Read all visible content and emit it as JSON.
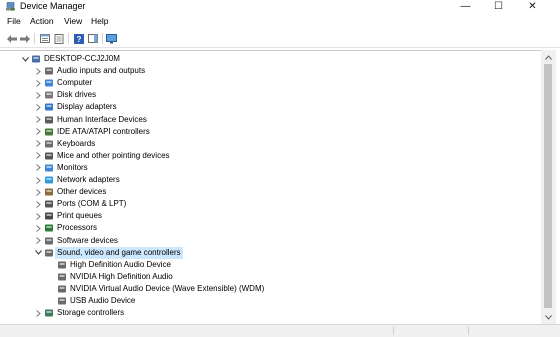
{
  "window": {
    "title": "Device Manager",
    "minimize": "—",
    "maximize": "☐",
    "close": "✕"
  },
  "menu": [
    "File",
    "Action",
    "View",
    "Help"
  ],
  "tree": {
    "root": "DESKTOP-CCJ2J0M",
    "items": [
      "Audio inputs and outputs",
      "Computer",
      "Disk drives",
      "Display adapters",
      "Human Interface Devices",
      "IDE ATA/ATAPI controllers",
      "Keyboards",
      "Mice and other pointing devices",
      "Monitors",
      "Network adapters",
      "Other devices",
      "Ports (COM & LPT)",
      "Print queues",
      "Processors",
      "Software devices",
      "Sound, video and game controllers"
    ],
    "sound_children": [
      "High Definition Audio Device",
      "NVIDIA High Definition Audio",
      "NVIDIA Virtual Audio Device (Wave Extensible) (WDM)",
      "USB Audio Device"
    ],
    "after": [
      "Storage controllers"
    ]
  },
  "colors": {
    "selection": "#cce8ff",
    "accent": "#0078d7"
  }
}
